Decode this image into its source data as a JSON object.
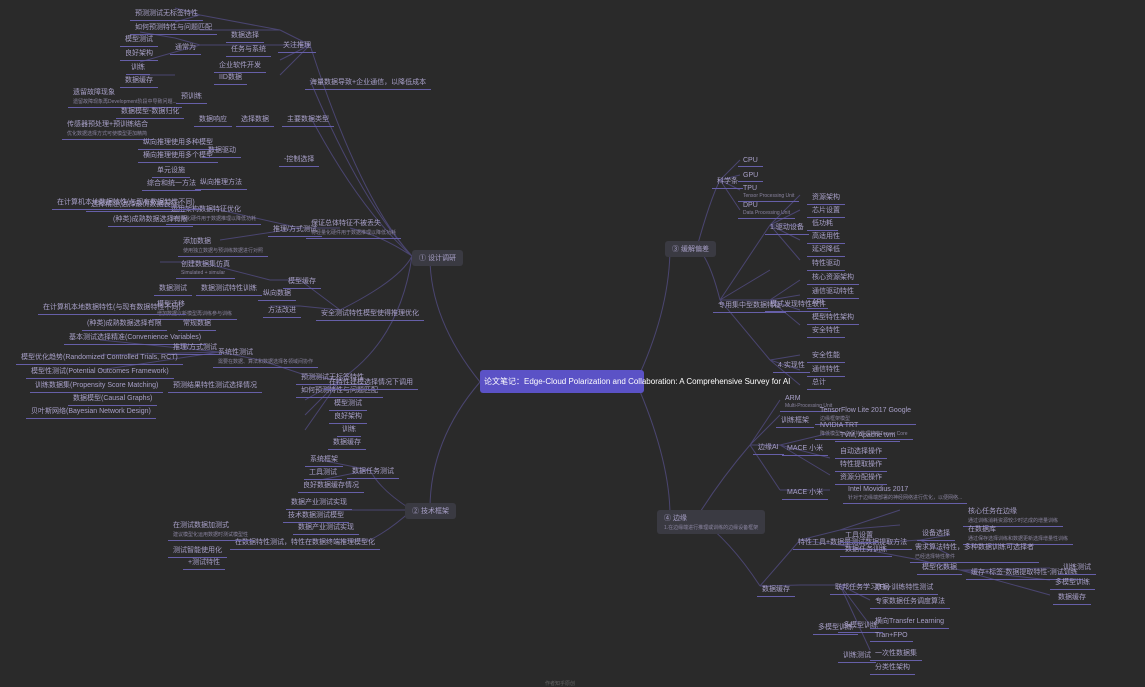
{
  "center": {
    "title": "论文笔记：Edge-Cloud Polarization and Collaboration: A Comprehensive Survey for AI"
  },
  "branches": {
    "left_top": {
      "label": "① 设计调研"
    },
    "left_bottom": {
      "label": "② 技术框架"
    },
    "right_top": {
      "label": "③ 缓解偏差"
    },
    "right_bottom": {
      "label": "④ 边缘",
      "sub": "1.在边缘端进行推理或训练的边缘设备框架"
    }
  },
  "footer": "作者知乎原创",
  "left_top_nodes": {
    "n1": "关注推理",
    "n2": "企业软件开发",
    "n2s": "通常为",
    "n3": "海量数据导致+企业通信，以降低成本",
    "n4": "主要数据类型",
    "n5": "IID数据",
    "n6": "数据选择",
    "n7": "任务与系统",
    "n8": "遗留故障现象",
    "n8s": "遗留故障现象再Development阶段中导致问题...",
    "n9": "数据模型-数据归化",
    "n10": "数据响应",
    "n11": "选择数据",
    "n12": "传感器预处理+预训练结合",
    "n12s": "优化数据选择方式可使模型更加精简",
    "n13": "纵向推理使用多种模型",
    "n14": "横向推理使用多个模型",
    "n15": "数据驱动",
    "n16": "单元设施",
    "n17": "综合和统一方法",
    "n18": "纵向推理方法",
    "n19": "预训练",
    "n20": "-控制选择",
    "n21": "保证总体特征不被丢失",
    "n22": "运用架构数据特征优化",
    "n22s": "将轻量化硬件用于数据推理以降低功耗",
    "n23": "选择精准(选择最优数据表征)",
    "n24": "添加数据",
    "n24s": "使用独立数据与预训练数据进行对照",
    "n25": "创建数据集仿真",
    "n25s": "Simulated + simular",
    "n26": "模型缓存",
    "n27": "纵向数据",
    "n28": "数据测试",
    "n29": "数据测试特性训练",
    "n30": "模型迁移",
    "n30s": "增加数据以新模型再训练参与训练",
    "n31": "方法改进",
    "n32": "安全测试特性模型使得推理优化",
    "n33": "在计算机本地数据特性(与现有数据特性不同)",
    "n34": "常规数据",
    "n35": "(种类)成熟数据选择有限",
    "n36": "基本测试选择精准(Convenience Variables)",
    "n37": "系统性测试",
    "n37s": "需要在数据、算法和数据选择各领域间协作",
    "n38": "推理/方式测试",
    "n39": "预测结果特性测试选择情况",
    "n40": "在特性建模选择情况下调用",
    "n41": "模型优化趋势(Randomized Controlled Trials, RCT)",
    "n42": "模型性测试(Potential Outcomes Framework)",
    "n43": "训练数据集(Propensity Score Matching)",
    "n44": "数据模型(Causal Graphs)",
    "n45": "贝叶斯网络(Bayesian Network Design)",
    "n46": "预测测试无标签特性",
    "n47": "如何预测特性与问题匹配",
    "n48": "模型测试",
    "n49": "良好架构",
    "n50": "训练",
    "n51": "数据缓存"
  },
  "left_bottom_nodes": {
    "b1": "系统框架",
    "b2": "工具测试",
    "b3": "数据任务测试",
    "b4": "良好数据缓存情况",
    "b5": "数据产业测试实现",
    "b6": "技术数据测试模型",
    "b7": "在数据特性测试，特性在数据终端推理模型化",
    "b8": "在测试数据加测式",
    "b8s": "建议模型化运用数据时测试模型性",
    "b9": "测试智能使用化",
    "b10": "+测试特性"
  },
  "right_top_nodes": {
    "r1": "科学条",
    "r2": "CPU",
    "r3": "GPU",
    "r4": "TPU",
    "r4s": "Tensor Processing Unit",
    "r5": "DPU",
    "r5s": "Data Processing Unit",
    "r6": "1.驱动设备",
    "r7": "资源架构",
    "r8": "芯片设置",
    "r9": "低功耗",
    "r10": "高适用性",
    "r11": "延迟降低",
    "r12": "特性驱动",
    "r13": "专用集中型数据特征",
    "r14": "模式发现特性软件",
    "r15": "核心资源架构",
    "r16": "通信驱动特性",
    "r17": "API",
    "r18": "模型特性架构",
    "r19": "安全特性",
    "r20": "4.实现性",
    "r21": "安全性能",
    "r22": "通信特性",
    "r23": "总计"
  },
  "right_bottom_nodes": {
    "e1": "边缘AI",
    "e2": "训练框架",
    "e3": "ARM",
    "e3s": "Multi-Processing Unit",
    "e4": "TensorFlow Lite 2017 Google",
    "e4s": "边缘框架模型",
    "e5": "NVIDIA TRT",
    "e5s": "降低模型5x在保持推理精度Tensor Core",
    "e6": "TVM, Apache tvm",
    "e7": "自动选择操作",
    "e8": "特性提取操作",
    "e9": "资源分配操作",
    "e10": "MACE 小米",
    "e11": "Intel Movidius 2017",
    "e11s": "针对于边缘端部署的神经网络进行优化，以便网络...",
    "e12": "设备选择",
    "e13": "工具设置",
    "e14": "核心任务在边缘",
    "e14s": "通过训练消耗资源较少时达成的增量训练",
    "e15": "在数据库",
    "e15s": "通过保存选择训练和数据更新选择增量性训练",
    "e16": "特性工具+数据量测试数据提取方法",
    "e17": "数据任务训练",
    "e18": "数据缓存",
    "e19": "需求算法特性，多种数据训练可选择者",
    "e19s": "已经选择特性条件",
    "e20": "模型化数据",
    "e21": "缓存+标签-数据提取特性-测试训练",
    "e22": "多模型训练",
    "e23": "训练测试",
    "e24": "联邦任务学习(FL)",
    "e25": "数据-训练特性测试",
    "e26": "专家数据任务调度算法",
    "e27": "横向Transfer Learning",
    "e28": "Tran+FPO",
    "e29": "一次性数据集",
    "e30": "分类性架构"
  }
}
